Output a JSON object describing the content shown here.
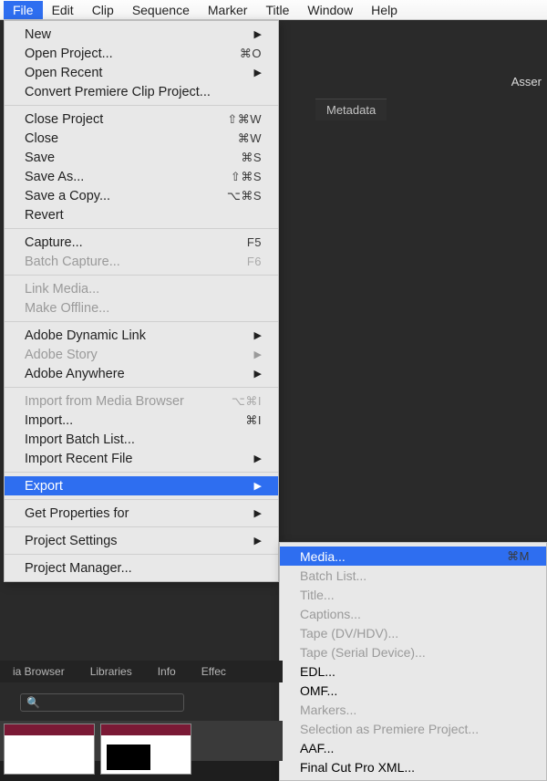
{
  "menubar": [
    "File",
    "Edit",
    "Clip",
    "Sequence",
    "Marker",
    "Title",
    "Window",
    "Help"
  ],
  "activeMenuIndex": 0,
  "panelTab": "Metadata",
  "cutoffLabel": "Asser",
  "fileMenu": [
    {
      "type": "item",
      "label": "New",
      "arrow": true
    },
    {
      "type": "item",
      "label": "Open Project...",
      "short": "⌘O"
    },
    {
      "type": "item",
      "label": "Open Recent",
      "arrow": true
    },
    {
      "type": "item",
      "label": "Convert Premiere Clip Project..."
    },
    {
      "type": "sep"
    },
    {
      "type": "item",
      "label": "Close Project",
      "short": "⇧⌘W"
    },
    {
      "type": "item",
      "label": "Close",
      "short": "⌘W"
    },
    {
      "type": "item",
      "label": "Save",
      "short": "⌘S"
    },
    {
      "type": "item",
      "label": "Save As...",
      "short": "⇧⌘S"
    },
    {
      "type": "item",
      "label": "Save a Copy...",
      "short": "⌥⌘S"
    },
    {
      "type": "item",
      "label": "Revert"
    },
    {
      "type": "sep"
    },
    {
      "type": "item",
      "label": "Capture...",
      "short": "F5"
    },
    {
      "type": "item",
      "label": "Batch Capture...",
      "short": "F6",
      "disabled": true
    },
    {
      "type": "sep"
    },
    {
      "type": "item",
      "label": "Link Media...",
      "disabled": true
    },
    {
      "type": "item",
      "label": "Make Offline...",
      "disabled": true
    },
    {
      "type": "sep"
    },
    {
      "type": "item",
      "label": "Adobe Dynamic Link",
      "arrow": true
    },
    {
      "type": "item",
      "label": "Adobe Story",
      "arrow": true,
      "disabled": true
    },
    {
      "type": "item",
      "label": "Adobe Anywhere",
      "arrow": true
    },
    {
      "type": "sep"
    },
    {
      "type": "item",
      "label": "Import from Media Browser",
      "short": "⌥⌘I",
      "disabled": true
    },
    {
      "type": "item",
      "label": "Import...",
      "short": "⌘I"
    },
    {
      "type": "item",
      "label": "Import Batch List..."
    },
    {
      "type": "item",
      "label": "Import Recent File",
      "arrow": true
    },
    {
      "type": "sep"
    },
    {
      "type": "item",
      "label": "Export",
      "arrow": true,
      "highlight": true
    },
    {
      "type": "sep"
    },
    {
      "type": "item",
      "label": "Get Properties for",
      "arrow": true
    },
    {
      "type": "sep"
    },
    {
      "type": "item",
      "label": "Project Settings",
      "arrow": true
    },
    {
      "type": "sep"
    },
    {
      "type": "item",
      "label": "Project Manager..."
    }
  ],
  "exportSubmenu": [
    {
      "label": "Media...",
      "short": "⌘M",
      "highlight": true
    },
    {
      "label": "Batch List...",
      "disabled": true
    },
    {
      "label": "Title...",
      "disabled": true
    },
    {
      "label": "Captions...",
      "disabled": true
    },
    {
      "label": "Tape (DV/HDV)...",
      "disabled": true
    },
    {
      "label": "Tape (Serial Device)...",
      "disabled": true
    },
    {
      "label": "EDL..."
    },
    {
      "label": "OMF..."
    },
    {
      "label": "Markers...",
      "disabled": true
    },
    {
      "label": "Selection as Premiere Project...",
      "disabled": true
    },
    {
      "label": "AAF..."
    },
    {
      "label": "Final Cut Pro XML..."
    }
  ],
  "bottomTabs": [
    "ia Browser",
    "Libraries",
    "Info",
    "Effec"
  ],
  "searchIcon": "🔍"
}
